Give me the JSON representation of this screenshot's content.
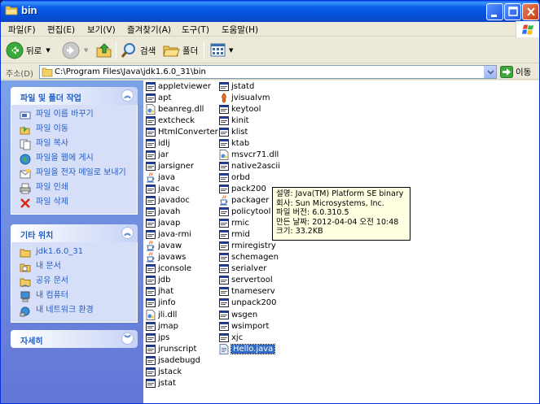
{
  "window": {
    "title": "bin"
  },
  "menu": [
    "파일(F)",
    "편집(E)",
    "보기(V)",
    "즐겨찾기(A)",
    "도구(T)",
    "도움말(H)"
  ],
  "toolbar": {
    "back": "뒤로",
    "search": "검색",
    "folders": "폴더"
  },
  "address": {
    "label": "주소(D)",
    "path": "C:\\Program Files\\Java\\jdk1.6.0_31\\bin",
    "go": "이동"
  },
  "tasks_panel": {
    "title": "파일 및 폴더 작업",
    "items": [
      "파일 이름 바꾸기",
      "파일 이동",
      "파일 복사",
      "파일을 웹에 게시",
      "파일을 전자 메일로 보내기",
      "파일 인쇄",
      "파일 삭제"
    ]
  },
  "places_panel": {
    "title": "기타 위치",
    "items": [
      "jdk1.6.0_31",
      "내 문서",
      "공유 문서",
      "내 컴퓨터",
      "내 네트워크 환경"
    ]
  },
  "details_panel": {
    "title": "자세히"
  },
  "files": {
    "col1": [
      {
        "name": "appletviewer",
        "icon": "exe"
      },
      {
        "name": "apt",
        "icon": "exe"
      },
      {
        "name": "beanreg.dll",
        "icon": "dll"
      },
      {
        "name": "extcheck",
        "icon": "exe"
      },
      {
        "name": "HtmlConverter",
        "icon": "exe"
      },
      {
        "name": "idlj",
        "icon": "exe"
      },
      {
        "name": "jar",
        "icon": "exe"
      },
      {
        "name": "jarsigner",
        "icon": "exe"
      },
      {
        "name": "java",
        "icon": "java"
      },
      {
        "name": "javac",
        "icon": "exe"
      },
      {
        "name": "javadoc",
        "icon": "exe"
      },
      {
        "name": "javah",
        "icon": "exe"
      },
      {
        "name": "javap",
        "icon": "exe"
      },
      {
        "name": "java-rmi",
        "icon": "exe"
      },
      {
        "name": "javaw",
        "icon": "java"
      },
      {
        "name": "javaws",
        "icon": "java"
      },
      {
        "name": "jconsole",
        "icon": "exe"
      },
      {
        "name": "jdb",
        "icon": "exe"
      },
      {
        "name": "jhat",
        "icon": "exe"
      },
      {
        "name": "jinfo",
        "icon": "exe"
      },
      {
        "name": "jli.dll",
        "icon": "dll"
      },
      {
        "name": "jmap",
        "icon": "exe"
      },
      {
        "name": "jps",
        "icon": "exe"
      },
      {
        "name": "jrunscript",
        "icon": "exe"
      },
      {
        "name": "jsadebugd",
        "icon": "exe"
      },
      {
        "name": "jstack",
        "icon": "exe"
      },
      {
        "name": "jstat",
        "icon": "exe"
      }
    ],
    "col2": [
      {
        "name": "jstatd",
        "icon": "exe"
      },
      {
        "name": "jvisualvm",
        "icon": "jvisualvm"
      },
      {
        "name": "keytool",
        "icon": "exe"
      },
      {
        "name": "kinit",
        "icon": "exe"
      },
      {
        "name": "klist",
        "icon": "exe"
      },
      {
        "name": "ktab",
        "icon": "exe"
      },
      {
        "name": "msvcr71.dll",
        "icon": "dll"
      },
      {
        "name": "native2ascii",
        "icon": "exe"
      },
      {
        "name": "orbd",
        "icon": "exe"
      },
      {
        "name": "pack200",
        "icon": "exe"
      },
      {
        "name": "packager",
        "icon": "java"
      },
      {
        "name": "policytool",
        "icon": "exe"
      },
      {
        "name": "rmic",
        "icon": "exe"
      },
      {
        "name": "rmid",
        "icon": "exe"
      },
      {
        "name": "rmiregistry",
        "icon": "exe"
      },
      {
        "name": "schemagen",
        "icon": "exe"
      },
      {
        "name": "serialver",
        "icon": "exe"
      },
      {
        "name": "servertool",
        "icon": "exe"
      },
      {
        "name": "tnameserv",
        "icon": "exe"
      },
      {
        "name": "unpack200",
        "icon": "exe"
      },
      {
        "name": "wsgen",
        "icon": "exe"
      },
      {
        "name": "wsimport",
        "icon": "exe"
      },
      {
        "name": "xjc",
        "icon": "exe"
      },
      {
        "name": "Hello.java",
        "icon": "javafile",
        "selected": true
      }
    ]
  },
  "tooltip": {
    "lines": [
      "설명: Java(TM) Platform SE binary",
      "회사: Sun Microsystems, Inc.",
      "파일 버전: 6.0.310.5",
      "만든 날짜: 2012-04-04 오전 10:48",
      "크기: 33.2KB"
    ]
  }
}
